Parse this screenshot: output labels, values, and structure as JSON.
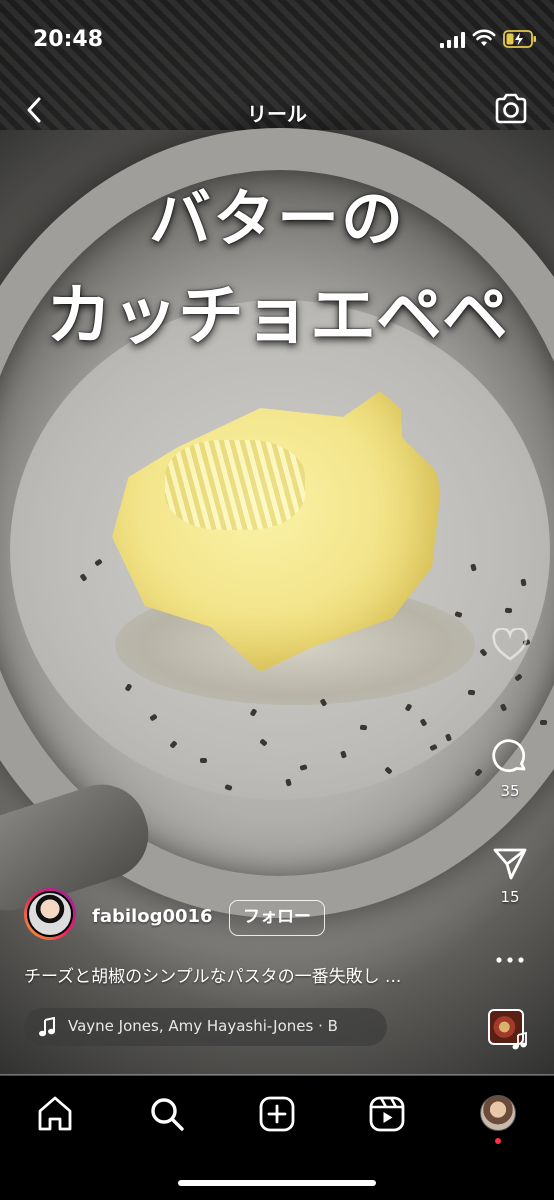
{
  "status_bar": {
    "time": "20:48"
  },
  "header": {
    "title": "リール"
  },
  "video": {
    "overlay_title_line1": "バターの",
    "overlay_title_line2": "カッチョエペペ",
    "progress_fraction": 0.0
  },
  "actions": {
    "comment_count": "35",
    "share_count": "15"
  },
  "post": {
    "username": "fabilog0016",
    "follow_label": "フォロー",
    "caption": "チーズと胡椒のシンプルなパスタの一番失敗し ...",
    "audio": "Vayne Jones, Amy Hayashi-Jones · B"
  },
  "icons": {
    "back": "chevron-left-icon",
    "camera": "camera-icon",
    "like": "heart-icon",
    "comment": "comment-icon",
    "share": "paper-plane-icon",
    "more": "more-dots-icon",
    "music": "music-note-icon",
    "home": "home-icon",
    "search": "search-icon",
    "create": "plus-square-icon",
    "reels": "reels-icon"
  },
  "colors": {
    "notification_dot": "#ff3040",
    "avatar_ring": [
      "#f9a825",
      "#e91e63",
      "#8e24aa"
    ]
  }
}
